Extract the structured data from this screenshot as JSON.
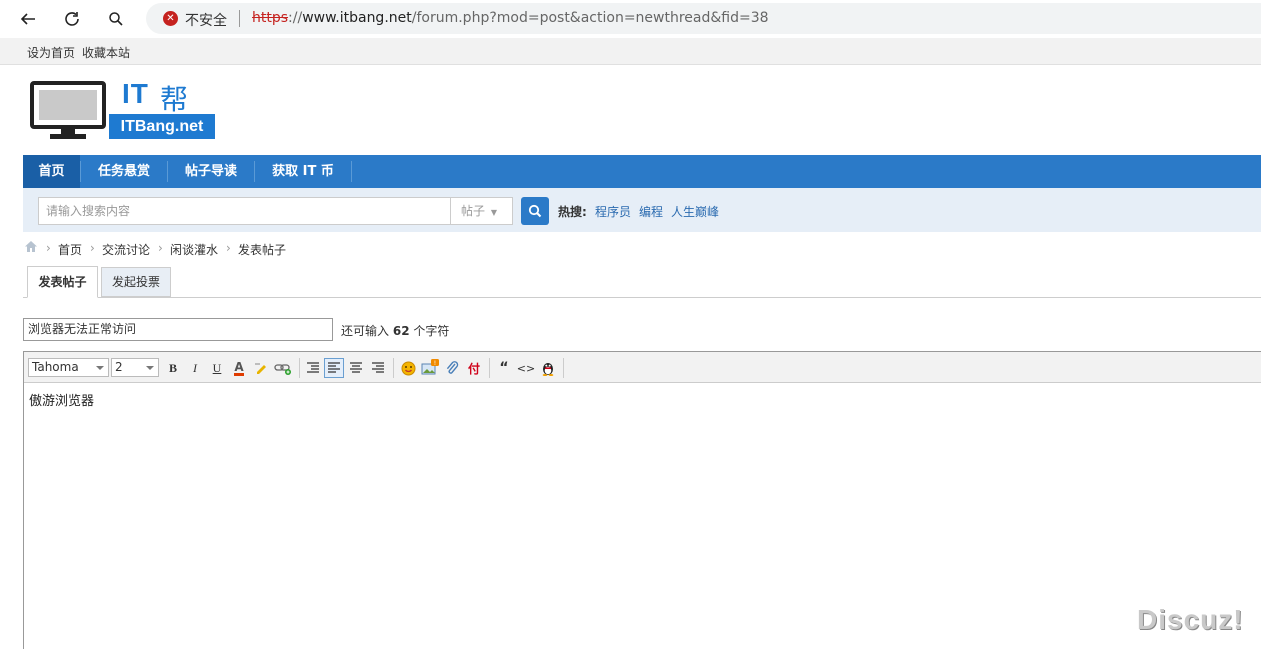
{
  "browser": {
    "security_label": "不安全",
    "url_scheme": "https",
    "url_sep": "://",
    "url_host": "www.itbang.net",
    "url_rest": "/forum.php?mod=post&action=newthread&fid=38"
  },
  "topbar": {
    "set_home": "设为首页",
    "bookmark": "收藏本站"
  },
  "logo": {
    "text_it": "IT",
    "text_bang": "帮",
    "text_sub": "ITBang.net"
  },
  "nav": {
    "items": [
      {
        "label": "首页"
      },
      {
        "label": "任务悬赏"
      },
      {
        "label": "帖子导读"
      },
      {
        "label": "获取 IT 币"
      }
    ]
  },
  "search": {
    "placeholder": "请输入搜索内容",
    "type_label": "帖子",
    "hot_label": "热搜:",
    "hot_items": [
      "程序员",
      "编程",
      "人生巅峰"
    ]
  },
  "breadcrumb": {
    "items": [
      "首页",
      "交流讨论",
      "闲谈灌水",
      "发表帖子"
    ],
    "sep": "›"
  },
  "tabs": {
    "post": "发表帖子",
    "poll": "发起投票"
  },
  "subject": {
    "value": "浏览器无法正常访问",
    "hint_prefix": "还可输入",
    "hint_count": "62",
    "hint_suffix": "个字符"
  },
  "editor": {
    "font_family": "Tahoma",
    "font_size": "2",
    "body": "傲游浏览器",
    "tools": {
      "bold": "B",
      "italic": "I",
      "underline": "U",
      "font_color": "A",
      "attach_label": "付",
      "quote": "“",
      "code": "<>"
    }
  },
  "watermark": "Discuz!",
  "colors": {
    "accent": "#2b7ac8",
    "nav_active": "#1a5fa6",
    "search_bg": "#e6eef7"
  }
}
